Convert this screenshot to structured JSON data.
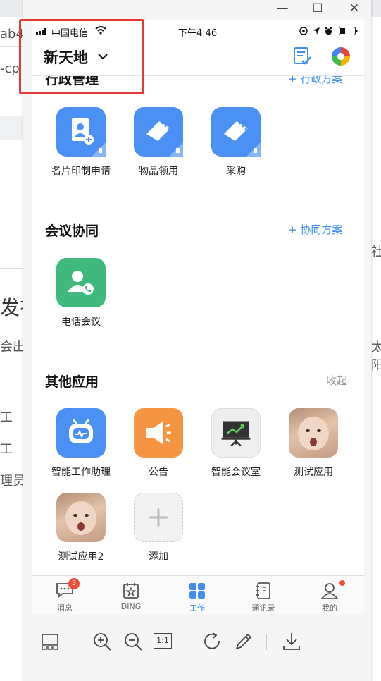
{
  "background": {
    "fragments": [
      "ab4",
      "-cp",
      "发布",
      "会出现",
      "工",
      "工",
      "理员",
      "社",
      "太阳"
    ]
  },
  "window": {
    "minimize_glyph": "—",
    "maximize_glyph": "☐",
    "close_glyph": "✕"
  },
  "statusbar": {
    "carrier": "中国电信",
    "time": "下午4:46"
  },
  "nav": {
    "org_name": "新天地"
  },
  "sections": {
    "admin": {
      "title": "行政管理",
      "link": "+ 行政方案",
      "apps": [
        {
          "label": "名片印制申请",
          "icon": "business-card-icon",
          "color": "#4a90f5"
        },
        {
          "label": "物品领用",
          "icon": "eraser-icon",
          "color": "#4a90f5"
        },
        {
          "label": "采购",
          "icon": "eraser-icon",
          "color": "#4a90f5"
        }
      ]
    },
    "meeting": {
      "title": "会议协同",
      "link": "+ 协同方案",
      "apps": [
        {
          "label": "电话会议",
          "icon": "phone-conference-icon",
          "color": "#3fba7c"
        }
      ]
    },
    "other": {
      "title": "其他应用",
      "link": "收起",
      "apps": [
        {
          "label": "智能工作助理",
          "icon": "robot-icon",
          "color": "#4a90f5"
        },
        {
          "label": "公告",
          "icon": "megaphone-icon",
          "color": "#f59441"
        },
        {
          "label": "智能会议室",
          "icon": "presentation-icon",
          "color": "#eeeeee"
        },
        {
          "label": "测试应用",
          "icon": "baby-photo-icon",
          "color": "#c9a48a"
        },
        {
          "label": "测试应用2",
          "icon": "baby-photo-icon",
          "color": "#c9a48a"
        },
        {
          "label": "添加",
          "icon": "plus-icon",
          "color": "#f2f2f2"
        }
      ]
    }
  },
  "tabbar": {
    "items": [
      {
        "label": "消息",
        "badge": "3"
      },
      {
        "label": "DING"
      },
      {
        "label": "工作",
        "active": true
      },
      {
        "label": "通讯录"
      },
      {
        "label": "我的"
      }
    ],
    "active_color": "#3f8ef0"
  },
  "toolbar": {
    "zoom_ratio": "1:1"
  }
}
